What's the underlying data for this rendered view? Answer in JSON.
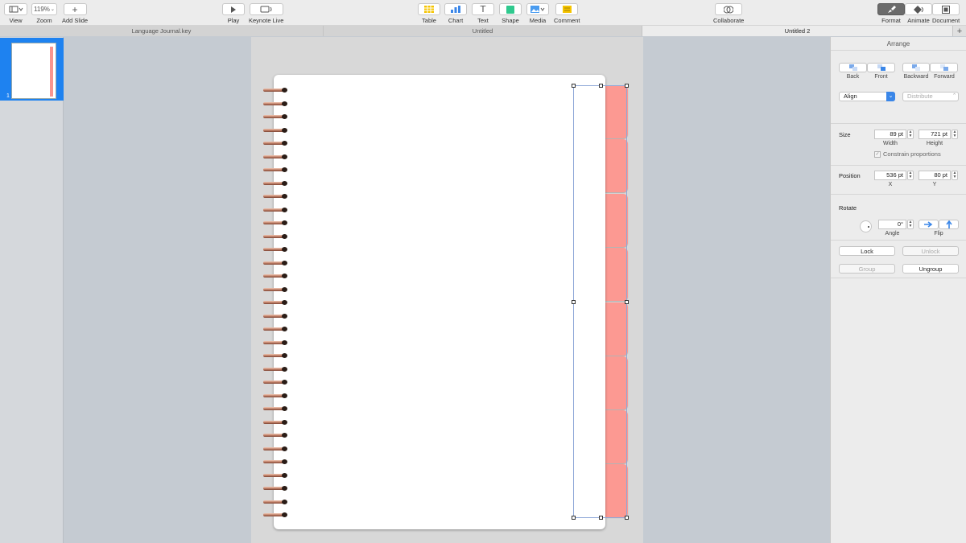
{
  "toolbar": {
    "view_label": "View",
    "zoom_value": "119%",
    "zoom_label": "Zoom",
    "add_slide_label": "Add Slide",
    "play_label": "Play",
    "keynote_live_label": "Keynote Live",
    "table_label": "Table",
    "chart_label": "Chart",
    "text_label": "Text",
    "shape_label": "Shape",
    "media_label": "Media",
    "comment_label": "Comment",
    "collaborate_label": "Collaborate",
    "format_label": "Format",
    "animate_label": "Animate",
    "document_label": "Document"
  },
  "tabs": [
    {
      "label": "Language Journal.key"
    },
    {
      "label": "Untitled"
    },
    {
      "label": "Untitled 2"
    }
  ],
  "navigator": {
    "slide_number": "1"
  },
  "inspector": {
    "header": "Arrange",
    "back_label": "Back",
    "front_label": "Front",
    "backward_label": "Backward",
    "forward_label": "Forward",
    "align_value": "Align",
    "distribute_value": "Distribute",
    "size_label": "Size",
    "width_value": "89 pt",
    "width_label": "Width",
    "height_value": "721 pt",
    "height_label": "Height",
    "constrain_label": "Constrain proportions",
    "position_label": "Position",
    "x_value": "536 pt",
    "x_label": "X",
    "y_value": "80 pt",
    "y_label": "Y",
    "rotate_label": "Rotate",
    "angle_value": "0°",
    "angle_label": "Angle",
    "flip_label": "Flip",
    "lock_label": "Lock",
    "unlock_label": "Unlock",
    "group_label": "Group",
    "ungroup_label": "Ungroup"
  },
  "colors": {
    "accent": "#1e82f0",
    "divider_tab": "#fc9992",
    "ring_hole": "#2a1c16"
  }
}
